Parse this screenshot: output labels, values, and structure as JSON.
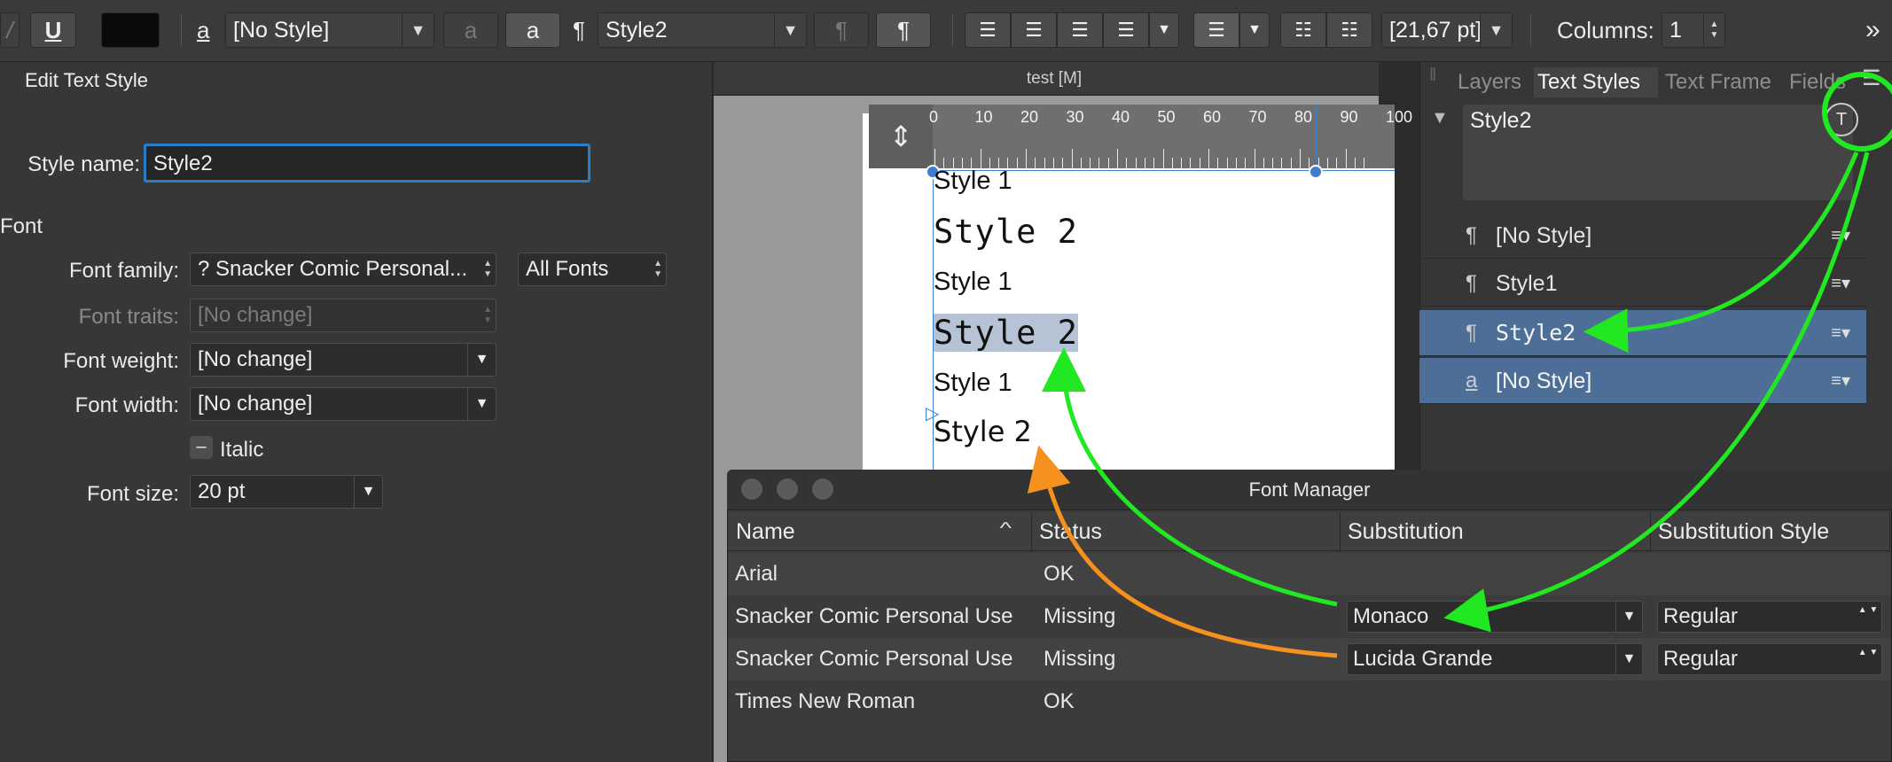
{
  "toolbar": {
    "italic_glyph": "/",
    "underline_glyph": "U",
    "char_style_icon": "a",
    "char_style_value": "[No Style]",
    "char_btn1": "a",
    "char_btn2": "a",
    "para_icon": "¶",
    "para_style_value": "Style2",
    "para_btn1": "¶",
    "para_btn2": "¶",
    "leading_value": "[21,67 pt]",
    "columns_label": "Columns:",
    "columns_value": "1",
    "overflow": "»",
    "swatch_color": "#0a0a0a"
  },
  "edit_panel": {
    "title": "Edit Text Style",
    "style_name_label": "Style name:",
    "style_name_value": "Style2",
    "section_font": "Font",
    "font_family_label": "Font family:",
    "font_family_value": "? Snacker Comic Personal...",
    "font_filter_value": "All Fonts",
    "font_traits_label": "Font traits:",
    "font_traits_value": "[No change]",
    "font_weight_label": "Font weight:",
    "font_weight_value": "[No change]",
    "font_width_label": "Font width:",
    "font_width_value": "[No change]",
    "italic_label": "Italic",
    "font_size_label": "Font size:",
    "font_size_value": "20 pt"
  },
  "document": {
    "tab_title": "test [M]",
    "ruler_numbers": [
      "0",
      "10",
      "20",
      "30",
      "40",
      "50",
      "60",
      "70",
      "80",
      "90",
      "100"
    ],
    "lines": [
      {
        "text": "Style 1",
        "kind": "s1"
      },
      {
        "text": "Style 2",
        "kind": "s2"
      },
      {
        "text": "Style 1",
        "kind": "s1"
      },
      {
        "text": "Style 2",
        "kind": "s2sel"
      },
      {
        "text": "Style 1",
        "kind": "s1"
      },
      {
        "text": "Style 2",
        "kind": "s2b"
      }
    ]
  },
  "styles_panel": {
    "tabs": [
      "Layers",
      "Text Styles",
      "Text Frame",
      "Fields"
    ],
    "active_tab": "Text Styles",
    "preview_name": "Style2",
    "items": [
      {
        "icon": "¶",
        "name": "[No Style]",
        "selected": false
      },
      {
        "icon": "¶",
        "name": "Style1",
        "selected": false
      },
      {
        "icon": "¶",
        "name": "Style2",
        "selected": true
      },
      {
        "icon": "a",
        "name": "[No Style]",
        "selected": true
      }
    ],
    "menu_glyph": "≡"
  },
  "font_manager": {
    "title": "Font Manager",
    "columns": [
      "Name",
      "Status",
      "Substitution",
      "Substitution Style"
    ],
    "sort_glyph": "^",
    "rows": [
      {
        "name": "Arial",
        "status": "OK",
        "substitution": "",
        "style": ""
      },
      {
        "name": "Snacker Comic Personal Use",
        "status": "Missing",
        "substitution": "Monaco",
        "style": "Regular"
      },
      {
        "name": "Snacker Comic Personal Use",
        "status": "Missing",
        "substitution": "Lucida Grande",
        "style": "Regular"
      },
      {
        "name": "Times New Roman",
        "status": "OK",
        "substitution": "",
        "style": ""
      }
    ]
  },
  "annotation_colors": {
    "green": "#22e822",
    "orange": "#f5911e"
  }
}
